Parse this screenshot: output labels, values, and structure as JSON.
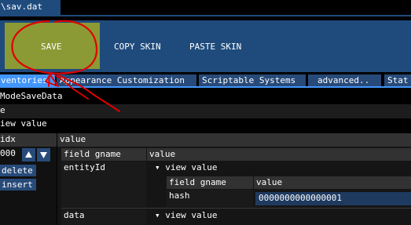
{
  "window": {
    "title_tab": "\\sav.dat"
  },
  "toolbar": {
    "save_label": "SAVE",
    "copy_skin_label": "COPY SKIN",
    "paste_skin_label": "PASTE SKIN"
  },
  "tabs": [
    {
      "label": "ventories",
      "active": true
    },
    {
      "label": "Appearance Customization",
      "active": false
    },
    {
      "label": "Scriptable Systems",
      "active": false
    },
    {
      "label": "advanced..",
      "active": false
    },
    {
      "label": "Stat",
      "active": false
    }
  ],
  "breadcrumb": "ModeSaveData",
  "tree": {
    "collapsed_row": "e",
    "view_value_row": "iew value"
  },
  "outer_table": {
    "col_idx": "idx",
    "col_value": "value",
    "row_index": "000",
    "delete_label": "delete",
    "insert_label": "insert"
  },
  "inner_table": {
    "col_field": "field gname",
    "col_value": "value",
    "rows": [
      {
        "field": "entityId",
        "view_value": "view value"
      },
      {
        "field": "data",
        "view_value": "view value"
      }
    ]
  },
  "nested_table": {
    "col_field": "field gname",
    "col_value": "value",
    "field": "hash",
    "value": "0000000000000001"
  },
  "colors": {
    "toolbar_bg": "#1f4b7c",
    "save_button_bg": "#8b9a34",
    "tab_active": "#4296fa",
    "tab_inactive": "#274a79",
    "annotation_red": "#e00000"
  },
  "annotation": {
    "type": "red hand-drawn circle and arrow pointing at SAVE button"
  }
}
